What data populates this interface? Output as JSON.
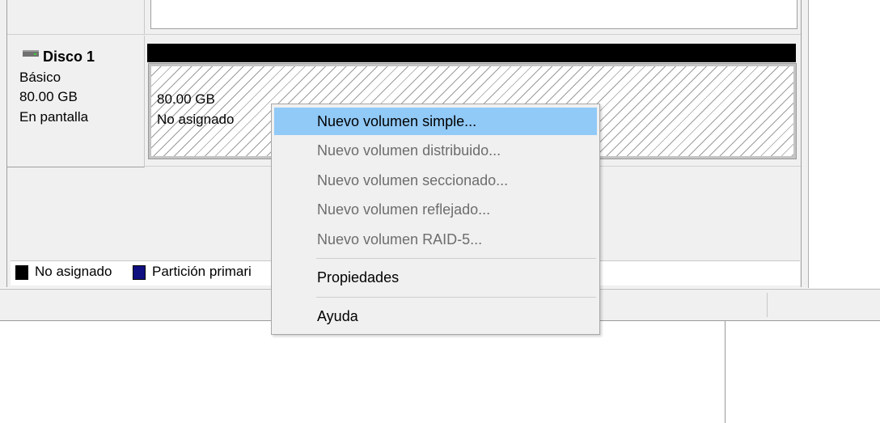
{
  "disk": {
    "name": "Disco 1",
    "type": "Básico",
    "size": "80.00 GB",
    "status": "En pantalla"
  },
  "volume": {
    "size": "80.00 GB",
    "status": "No asignado"
  },
  "legend": {
    "unallocated_label": "No asignado",
    "primary_label": "Partición primari",
    "unallocated_color": "#000000",
    "primary_color": "#0f0f80"
  },
  "context_menu": {
    "items": [
      {
        "label": "Nuevo volumen simple...",
        "enabled": true,
        "highlighted": true
      },
      {
        "label": "Nuevo volumen distribuido...",
        "enabled": false
      },
      {
        "label": "Nuevo volumen seccionado...",
        "enabled": false
      },
      {
        "label": "Nuevo volumen reflejado...",
        "enabled": false
      },
      {
        "label": "Nuevo volumen RAID-5...",
        "enabled": false
      },
      {
        "label": "Propiedades",
        "enabled": true
      },
      {
        "label": "Ayuda",
        "enabled": true
      }
    ],
    "highlight_color": "#91c9f7",
    "disabled_text_color": "#6d6d6d"
  },
  "icons": {
    "disk_icon": "hard-disk-icon"
  }
}
